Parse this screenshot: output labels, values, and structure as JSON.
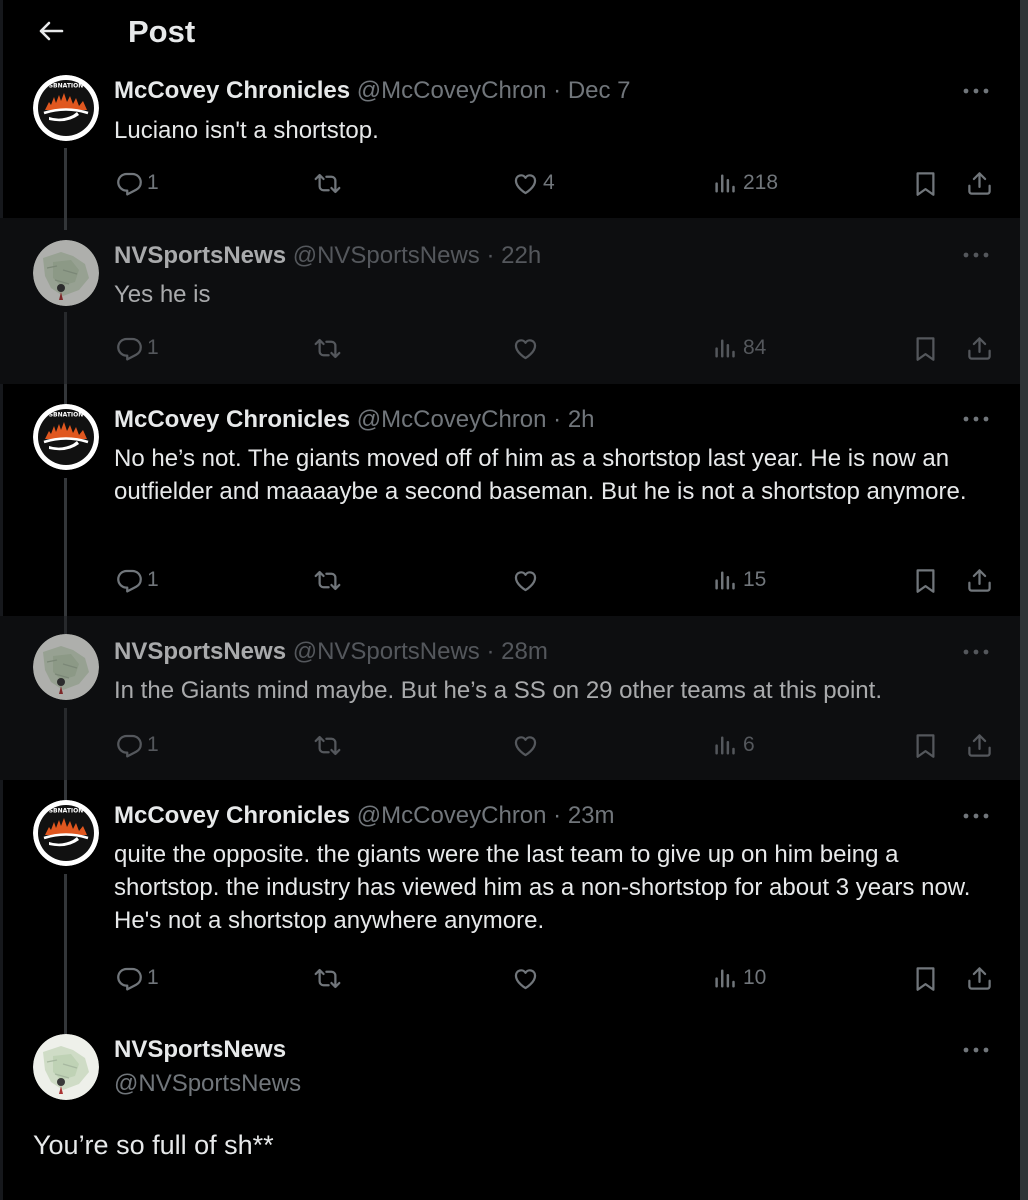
{
  "header": {
    "title": "Post"
  },
  "tweets": [
    {
      "name": "McCovey Chronicles",
      "handle": "@McCoveyChron · Dec 7",
      "text": "Luciano isn't a shortstop.",
      "replies": "1",
      "likes": "4",
      "views": "218"
    },
    {
      "name": "NVSportsNews",
      "handle": "@NVSportsNews · 22h",
      "text": "Yes he is",
      "replies": "1",
      "likes": "",
      "views": "84"
    },
    {
      "name": "McCovey Chronicles",
      "handle": "@McCoveyChron · 2h",
      "text": "No he’s not. The giants moved off of him as a shortstop last year. He is now an outfielder and maaaaybe a second baseman. But he is not a shortstop anymore.",
      "replies": "1",
      "likes": "",
      "views": "15"
    },
    {
      "name": "NVSportsNews",
      "handle": "@NVSportsNews · 28m",
      "text": "In the Giants mind maybe. But he’s a SS on 29 other teams at this point.",
      "replies": "1",
      "likes": "",
      "views": "6"
    },
    {
      "name": "McCovey Chronicles",
      "handle": "@McCoveyChron · 23m",
      "text": "quite the opposite. the giants were the last team to give up on him being a shortstop. the industry has viewed him as a non-shortstop for about 3 years now. He's not a shortstop anywhere anymore.",
      "replies": "1",
      "likes": "",
      "views": "10"
    }
  ],
  "main_post": {
    "name": "NVSportsNews",
    "handle": "@NVSportsNews",
    "text": "You’re so full of sh**"
  },
  "colors": {
    "background": "#000000",
    "text": "#e7e9ea",
    "muted": "#71767b",
    "accent_orange": "#e0571f"
  },
  "icons": {
    "back": "arrow-left-icon",
    "reply": "reply-icon",
    "retweet": "retweet-icon",
    "like": "heart-icon",
    "views": "views-icon",
    "bookmark": "bookmark-icon",
    "share": "share-icon",
    "more": "more-icon"
  }
}
